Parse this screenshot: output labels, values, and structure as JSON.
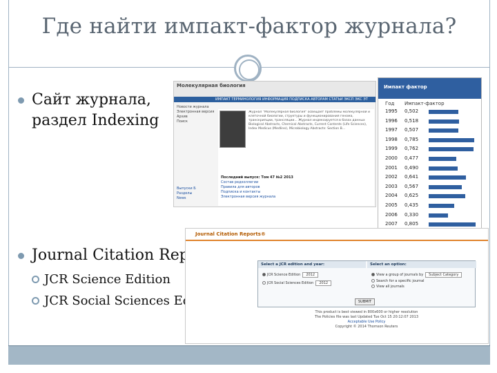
{
  "slide": {
    "title": "Где найти импакт-фактор журнала?",
    "bullet1_line1": "Сайт журнала,",
    "bullet1_line2": "раздел Indexing",
    "bullet2": "Journal Citation Report",
    "sub1": "JCR Science Edition",
    "sub2": "JCR Social Sciences Edition",
    "accent_color": "#9fb2c3",
    "bar_color": "#2f5fa0"
  },
  "journal_site": {
    "name": "Молекулярная биология",
    "nav": "ИМПАКТ  ТЕРМИНОЛОГИЯ  ИНФОРМАЦИЯ  ПОДПИСКА  АВТОРАМ  СТАТЬИ  ЭКСП  ЭКС  ЭТ",
    "left_items": [
      "Новости журнала",
      "Электронная версия",
      "Архив",
      "Поиск"
    ],
    "left_links": [
      "Выпуски Б",
      "Разделы",
      "News"
    ],
    "text": "Журнал \"Молекулярная биология\" освещает проблемы молекулярной и клеточной биологии, структуры и функционирования генома, транскрипции, трансляции... Журнал индексируется в базах данных Biological Abstracts, Chemical Abstracts, Current Contents (Life Sciences), Index Medicus (Medline), Microbiology Abstracts: Section B...",
    "links": [
      "Последний выпуск: Том 47 №2 2013",
      "Состав редколлегии",
      "Правила для авторов",
      "Подписка и контакты",
      "Электронная версия журнала"
    ]
  },
  "impact_table": {
    "title": "Импакт фактор",
    "col_year": "Год",
    "col_value": "Импакт-фактор",
    "rows": [
      {
        "year": "1995",
        "value": "0,502"
      },
      {
        "year": "1996",
        "value": "0,518"
      },
      {
        "year": "1997",
        "value": "0,507"
      },
      {
        "year": "1998",
        "value": "0,785"
      },
      {
        "year": "1999",
        "value": "0,762"
      },
      {
        "year": "2000",
        "value": "0,477"
      },
      {
        "year": "2001",
        "value": "0,490"
      },
      {
        "year": "2002",
        "value": "0,641"
      },
      {
        "year": "2003",
        "value": "0,567"
      },
      {
        "year": "2004",
        "value": "0,625"
      },
      {
        "year": "2005",
        "value": "0,435"
      },
      {
        "year": "2006",
        "value": "0,330"
      },
      {
        "year": "2007",
        "value": "0,805"
      },
      {
        "year": "2008",
        "value": "0,849"
      }
    ]
  },
  "jcr": {
    "logo": "Journal Citation Reports®",
    "form_title_left": "Select a JCR edition and year:",
    "form_title_right": "Select an option:",
    "edition1": "JCR Science Edition",
    "edition2": "JCR Social Sciences Edition",
    "year": "2012",
    "option1": "View a group of journals by",
    "option1_select": "Subject Category",
    "option2": "Search for a specific journal",
    "option3": "View all journals",
    "submit": "SUBMIT",
    "note1": "This product is best viewed in 800x600 or higher resolution",
    "note2": "The Policies file was last Updated Tue Oct 15 20:12:07 2013",
    "note3": "Acceptable Use Policy",
    "note4": "Copyright © 2014 Thomson Reuters"
  }
}
